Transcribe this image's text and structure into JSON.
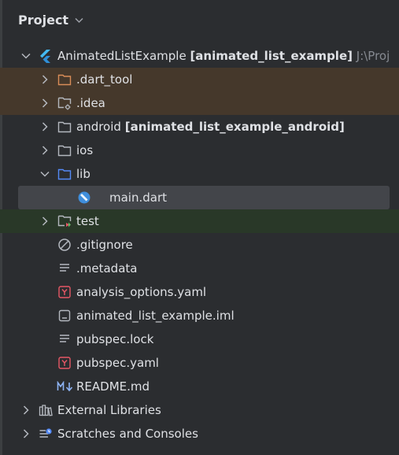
{
  "panel": {
    "title": "Project"
  },
  "tree": {
    "root": {
      "name": "AnimatedListExample",
      "module": "[animated_list_example]",
      "path": "J:\\Proj"
    },
    "dart_tool": {
      "name": ".dart_tool"
    },
    "idea": {
      "name": ".idea"
    },
    "android": {
      "name": "android",
      "module": "[animated_list_example_android]"
    },
    "ios": {
      "name": "ios"
    },
    "lib": {
      "name": "lib"
    },
    "main_dart": {
      "name": "main.dart"
    },
    "test": {
      "name": "test"
    },
    "gitignore": {
      "name": ".gitignore"
    },
    "metadata": {
      "name": ".metadata"
    },
    "analysis_options": {
      "name": "analysis_options.yaml"
    },
    "iml": {
      "name": "animated_list_example.iml"
    },
    "pubspec_lock": {
      "name": "pubspec.lock"
    },
    "pubspec_yaml": {
      "name": "pubspec.yaml"
    },
    "readme": {
      "name": "README.md"
    },
    "external_libraries": {
      "name": "External Libraries"
    },
    "scratches": {
      "name": "Scratches and Consoles"
    }
  },
  "icons": {
    "project": "flutter-icon",
    "folder": "folder-icon",
    "excluded_folder": "excluded-folder-icon",
    "dart_file": "dart-file-icon",
    "yaml_file": "yaml-icon",
    "text_file": "text-file-icon",
    "iml_file": "iml-file-icon",
    "markdown_file": "markdown-icon",
    "ignore_file": "gitignore-icon",
    "libraries": "libraries-icon",
    "scratches": "scratches-icon"
  },
  "colors": {
    "background": "#2b2d30",
    "excluded_row": "#45382b",
    "selected_row": "#43454a",
    "test_row": "#293828",
    "folder_accent": "#548af7",
    "excluded_folder": "#d98d58",
    "yaml_red": "#e55765"
  }
}
